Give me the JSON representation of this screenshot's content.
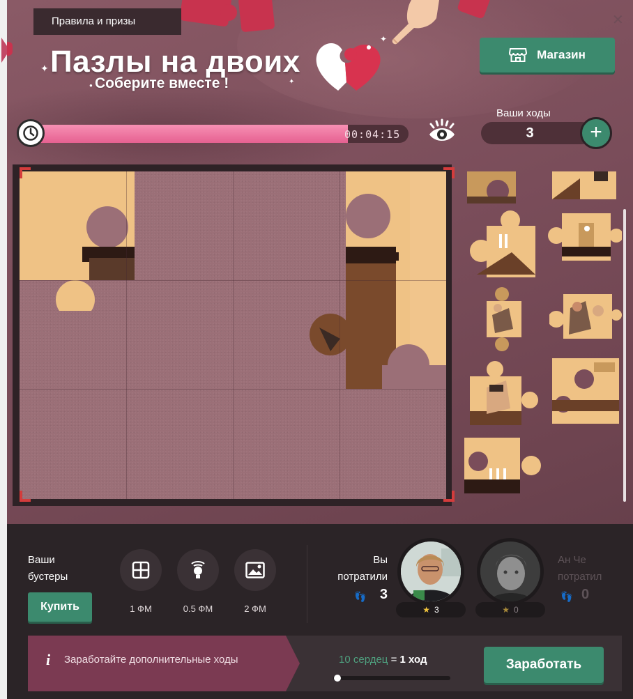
{
  "header": {
    "rules_tab": "Правила и призы",
    "title": "Пазлы на двоих",
    "subtitle": "Соберите вместе !",
    "shop_button": "Магазин"
  },
  "timer": {
    "time": "00:04:15",
    "progress": 0.84
  },
  "moves": {
    "label": "Ваши ходы",
    "value": "3"
  },
  "boosters": {
    "label": "Ваши бустеры",
    "buy_button": "Купить",
    "items": [
      {
        "icon": "grid-icon",
        "price": "1 ФМ"
      },
      {
        "icon": "lightbulb-icon",
        "price": "0.5 ФМ"
      },
      {
        "icon": "picture-icon",
        "price": "2 ФМ"
      }
    ]
  },
  "players": {
    "you": {
      "label": "Вы потратили",
      "spent": "3",
      "stars": "3"
    },
    "partner": {
      "label": "Ан Че потратил",
      "spent": "0",
      "stars": "0"
    }
  },
  "earn": {
    "text": "Заработайте дополнительные ходы",
    "hearts_rate_prefix": "10 сердец",
    "hearts_rate_equals": "=",
    "hearts_rate_suffix": "1 ход",
    "hearts_progress": 0.02,
    "button": "Заработать"
  },
  "colors": {
    "accent_green": "#3c8a6e",
    "timer_pink": "#e66191",
    "brand_red": "#c8334e"
  }
}
